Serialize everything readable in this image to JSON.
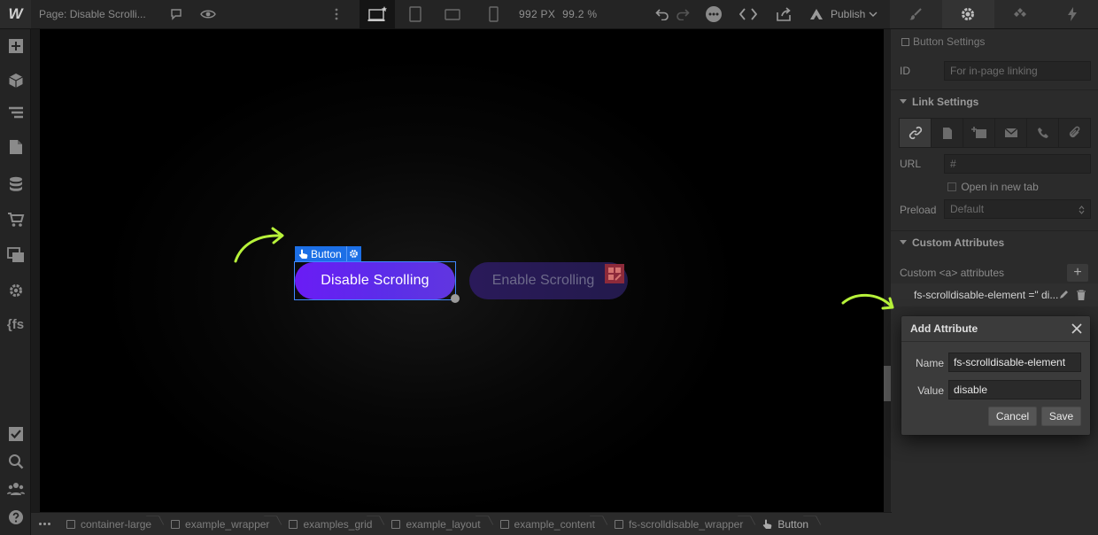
{
  "topbar": {
    "logo": "W",
    "page_label": "Page: Disable Scrolli...",
    "canvas_width": "992 PX",
    "zoom": "99.2 %",
    "publish_label": "Publish"
  },
  "canvas": {
    "selected_label": "Button",
    "button_disable": "Disable Scrolling",
    "button_enable": "Enable Scrolling",
    "accent_color": "#5b2ee8",
    "selection_color": "#1c6fe6",
    "arrow_color": "#b7f23a"
  },
  "panel": {
    "element_title": "Button Settings",
    "id_label": "ID",
    "id_placeholder": "For in-page linking",
    "link_settings_label": "Link Settings",
    "url_label": "URL",
    "url_value": "#",
    "open_new_tab": "Open in new tab",
    "preload_label": "Preload",
    "preload_value": "Default",
    "custom_attributes_label": "Custom Attributes",
    "custom_for_label": "Custom <a> attributes",
    "attribute_row": "fs-scrolldisable-element =\" di..."
  },
  "dialog": {
    "title": "Add Attribute",
    "name_label": "Name",
    "name_value": "fs-scrolldisable-element",
    "value_label": "Value",
    "value_value": "disable",
    "cancel": "Cancel",
    "save": "Save"
  },
  "breadcrumbs": [
    "container-large",
    "example_wrapper",
    "examples_grid",
    "example_layout",
    "example_content",
    "fs-scrolldisable_wrapper",
    "Button"
  ],
  "left_tools": {
    "fs_label": "{fs"
  }
}
